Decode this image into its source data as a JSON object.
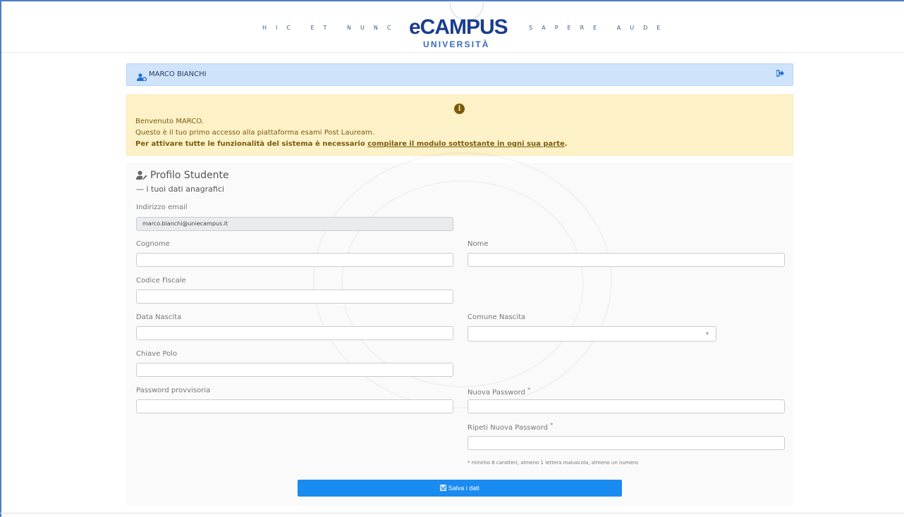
{
  "header": {
    "motto_left": "HIC ET NUNC",
    "motto_right": "SAPERE AUDE",
    "logo_main": "eCAMPUS",
    "logo_sub": "UNIVERSITÀ"
  },
  "userbar": {
    "name": "MARCO BIANCHI",
    "user_icon": "user-gear-icon",
    "logout_icon": "sign-out-icon"
  },
  "alert": {
    "icon": "info-circle-icon",
    "line1": "Benvenuto MARCO.",
    "line2": "Questo è il tuo primo accesso alla piattaforma esami Post Lauream.",
    "line3_prefix": "Per attivare tutte le funzionalità del sistema è necessario ",
    "line3_link": "compilare il modulo sottostante in ogni sua parte",
    "line3_suffix": "."
  },
  "profile": {
    "title": "Profilo Studente",
    "subtitle": "— i tuoi dati anagrafici",
    "icon": "user-edit-icon"
  },
  "form": {
    "email_label": "Indirizzo email",
    "email_value": "marco.bianchi@uniecampus.it",
    "cognome_label": "Cognome",
    "cognome_value": "",
    "nome_label": "Nome",
    "nome_value": "",
    "codice_fiscale_label": "Codice Fiscale",
    "codice_fiscale_value": "",
    "data_nascita_label": "Data Nascita",
    "data_nascita_value": "",
    "comune_nascita_label": "Comune Nascita",
    "comune_nascita_value": "",
    "chiave_polo_label": "Chiave Polo",
    "chiave_polo_value": "",
    "password_provvisoria_label": "Password provvisoria",
    "password_provvisoria_value": "",
    "nuova_password_label": "Nuova Password",
    "nuova_password_value": "",
    "ripeti_password_label": "Ripeti Nuova Password",
    "ripeti_password_value": "",
    "required_mark": "*",
    "password_hint": "* minimo 8 caratteri, almeno 1 lettera maiuscola, almeno un numero",
    "save_label": "Salva i dati",
    "save_icon": "floppy-disk-icon"
  },
  "colors": {
    "brand": "#1a3d8c",
    "userbar_bg": "#cfe3fa",
    "alert_bg": "#fdf1c8",
    "button": "#1a8bf0"
  }
}
